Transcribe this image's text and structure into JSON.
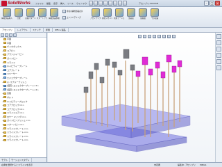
{
  "app": {
    "logo_text": "SolidWorks",
    "menus": [
      "ファイル",
      "編集",
      "表示",
      "挿入",
      "ツール",
      "ウィンドウ",
      "ヘルプ"
    ],
    "title_right": "アセンブリ.SLDASM",
    "window_buttons": [
      "–",
      "□",
      "×"
    ]
  },
  "ribbon": {
    "large_buttons": [
      "構成部品挿入",
      "合致",
      "直線パターン",
      "スマートファスナー",
      "構成部品移動",
      "アセンブリフィーチャー",
      "参照ジオメトリ",
      "新規モーション",
      "部品表",
      "展開図",
      "干渉認識"
    ],
    "small_buttons": [
      "非表示構成部品表示",
      "エンジニアリング"
    ]
  },
  "tabs": [
    "アセンブリ",
    "レイアウト",
    "スケッチ",
    "評価",
    "Office 製品"
  ],
  "tree": {
    "items": [
      {
        "label": "平面",
        "icon": "folder",
        "expander": ""
      },
      {
        "label": "平面",
        "icon": "folder",
        "expander": ""
      },
      {
        "label": "ギャオボックス",
        "icon": "folder",
        "expander": "+"
      },
      {
        "label": "コアビン",
        "icon": "folder",
        "expander": "+"
      },
      {
        "label": "プランジャーピン",
        "icon": "folder",
        "expander": "+"
      },
      {
        "label": "ガイドピン",
        "icon": "folder",
        "expander": "+"
      },
      {
        "label": "スライド",
        "icon": "folder",
        "expander": "+"
      },
      {
        "label": "キャビティープレート",
        "icon": "blue",
        "expander": "+"
      },
      {
        "label": "コアプレート",
        "icon": "blue",
        "expander": "+"
      },
      {
        "label": "スペーサー",
        "icon": "blue",
        "expander": "+"
      },
      {
        "label": "エジェクタープレート",
        "icon": "blue",
        "expander": "+"
      },
      {
        "label": "(-) スプルーブッシュ",
        "icon": "folder",
        "expander": "+"
      },
      {
        "label": "(固定) エジェクタープレート<1>",
        "icon": "blue",
        "expander": "+"
      },
      {
        "label": "(固定) エジェクタープレート<2>",
        "icon": "blue",
        "expander": "+"
      },
      {
        "label": "合致",
        "icon": "folder",
        "expander": "+"
      },
      {
        "label": "ボルト",
        "icon": "folder",
        "expander": "+"
      },
      {
        "label": "キャビティーブロック",
        "icon": "folder",
        "expander": "+"
      },
      {
        "label": "コアブロック<1>",
        "icon": "folder",
        "expander": "+"
      },
      {
        "label": "コアブロック<2>",
        "icon": "folder",
        "expander": "+"
      },
      {
        "label": "スライドコア<1>",
        "icon": "folder",
        "expander": "+"
      },
      {
        "label": "ロケートリング<1>",
        "icon": "folder",
        "expander": "+"
      },
      {
        "label": "ガイドピンブッシュ<1>",
        "icon": "folder",
        "expander": "+"
      },
      {
        "label": "リターンピン<1>",
        "icon": "folder",
        "expander": "+"
      },
      {
        "label": "スライドプレート<1>",
        "icon": "folder",
        "expander": "+"
      },
      {
        "label": "スライドプレート<2>",
        "icon": "folder",
        "expander": "+"
      },
      {
        "label": "スライドプレート<3>",
        "icon": "folder",
        "expander": "+"
      },
      {
        "label": "スライドプレート<4>",
        "icon": "folder",
        "expander": "+"
      }
    ],
    "bottom_tabs": [
      "モデル",
      "モーションスタディ"
    ]
  },
  "status": {
    "left": "右側を選択するとスライドを表示",
    "r1": "未定義",
    "r2": "編集中: アセンブリ",
    "r3": "MMGS"
  },
  "colors": {
    "pink_blocks": "#e02bd6",
    "gray_blocks": "#7a7c82",
    "plate_fill": "#6f6fe0",
    "pin": "#c8a27a"
  }
}
